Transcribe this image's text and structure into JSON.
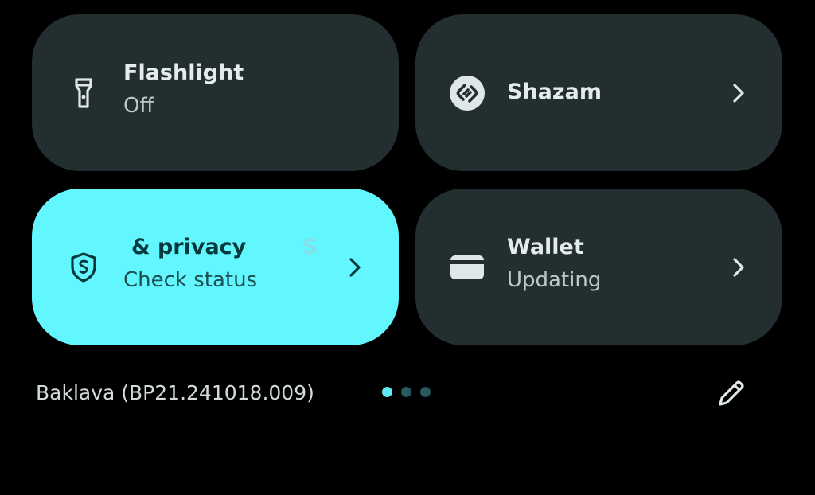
{
  "tiles": {
    "flashlight": {
      "title": "Flashlight",
      "subtitle": "Off",
      "icon": "flashlight-icon"
    },
    "shazam": {
      "title": "Shazam",
      "icon": "shazam-icon"
    },
    "security": {
      "title": "& privacy",
      "ghost_text": "S",
      "subtitle": "Check status",
      "icon": "shield-icon"
    },
    "wallet": {
      "title": "Wallet",
      "subtitle": "Updating",
      "icon": "wallet-icon"
    }
  },
  "footer": {
    "build": "Baklava (BP21.241018.009)",
    "pages": 3,
    "current_page": 1
  },
  "colors": {
    "background": "#000000",
    "tile_inactive": "#222e30",
    "tile_active": "#62f6fe",
    "dot_active": "#5fe9f1",
    "dot_inactive": "#26585c"
  }
}
